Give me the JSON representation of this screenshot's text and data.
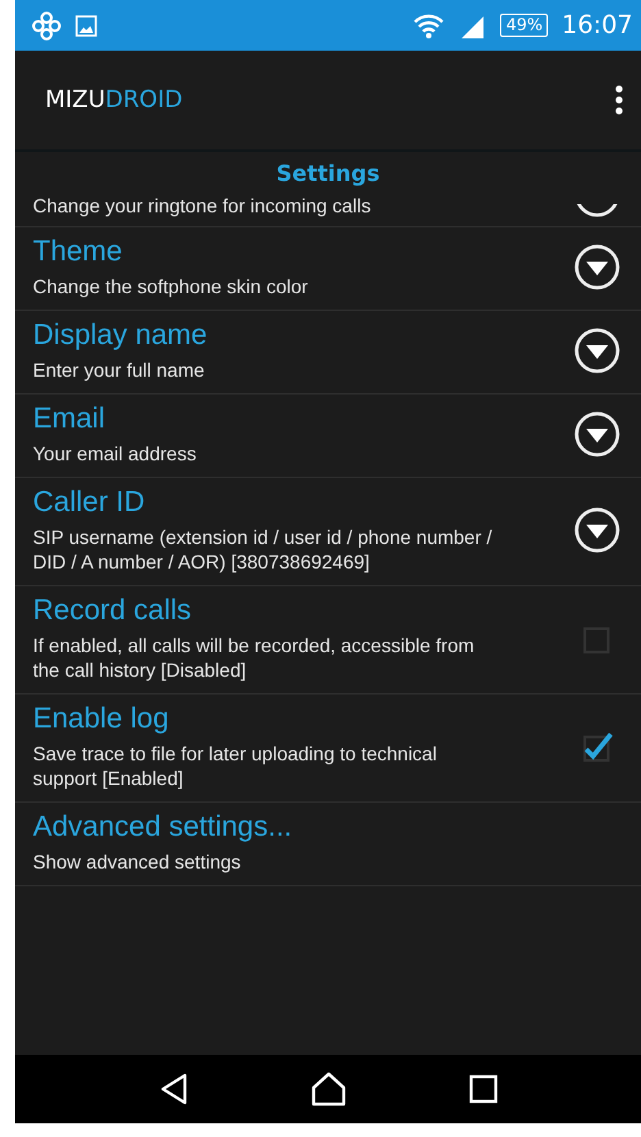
{
  "status_bar": {
    "battery": "49%",
    "time": "16:07"
  },
  "app_bar": {
    "brand_first": "MIZU",
    "brand_second": "DROID"
  },
  "header": {
    "title": "Settings"
  },
  "partial_item": {
    "summary": "Change your ringtone for incoming calls",
    "kind": "dropdown"
  },
  "items": [
    {
      "title": "Theme",
      "summary": "Change the softphone skin color",
      "kind": "dropdown"
    },
    {
      "title": "Display name",
      "summary": "Enter your full name",
      "kind": "dropdown"
    },
    {
      "title": "Email",
      "summary": "Your email address",
      "kind": "dropdown"
    },
    {
      "title": "Caller ID",
      "summary": "SIP username (extension id / user id / phone number / DID / A number / AOR) [380738692469]",
      "kind": "dropdown"
    },
    {
      "title": "Record calls",
      "summary": "If enabled, all calls will be recorded, accessible from the call history [Disabled]",
      "kind": "checkbox",
      "checked": false
    },
    {
      "title": "Enable log",
      "summary": "Save trace to file for later uploading to technical support [Enabled]",
      "kind": "checkbox",
      "checked": true
    },
    {
      "title": "Advanced settings...",
      "summary": "Show advanced settings",
      "kind": "plain"
    }
  ]
}
